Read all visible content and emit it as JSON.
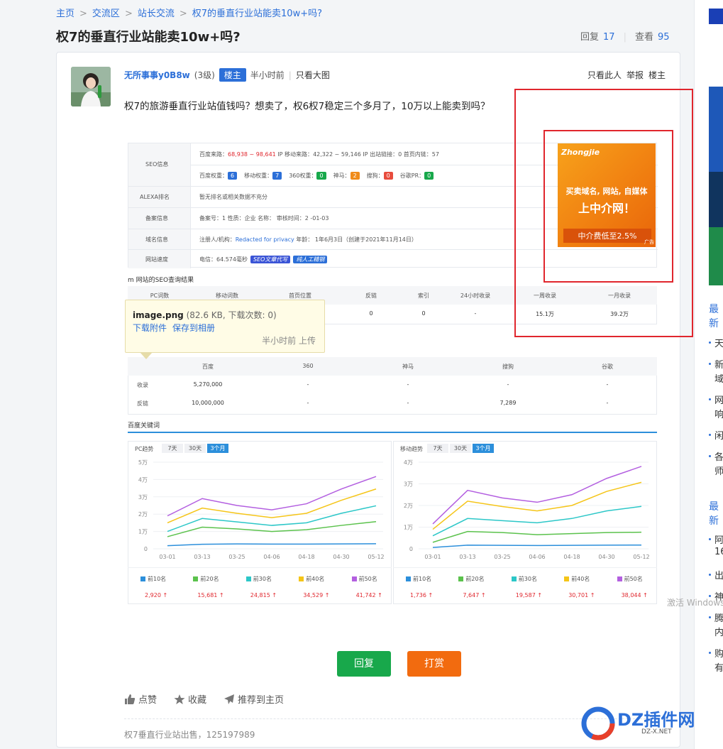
{
  "breadcrumb": [
    "主页",
    "交流区",
    "站长交流",
    "权7的垂直行业站能卖10w+吗?"
  ],
  "thread": {
    "title": "权7的垂直行业站能卖10w+吗?",
    "reply_label": "回复",
    "reply_count": "17",
    "view_label": "查看",
    "view_count": "95"
  },
  "post": {
    "author": "无所事事y0B8w",
    "level": "(3级)",
    "badge": "楼主",
    "time": "半小时前",
    "only_big": "只看大图",
    "tools": [
      "只看此人",
      "举报",
      "楼主"
    ],
    "content": "权7的旅游垂直行业站值钱吗？想卖了，权6权7稳定三个多月了，10万以上能卖到吗？"
  },
  "seo": {
    "rows": [
      {
        "label": "SEO信息",
        "line1_parts": [
          "百度来路：",
          "68,938 ~ 98,641",
          " IP   移动来路：",
          "42,322 ~ 59,146",
          " IP   出站链接：",
          "0",
          "   首页内链：",
          "57"
        ],
        "line2": [
          {
            "k": "百度权重：",
            "v": "6",
            "c": "#2c6fd8"
          },
          {
            "k": "移动权重：",
            "v": "7",
            "c": "#2c6fd8"
          },
          {
            "k": "360权重：",
            "v": "0",
            "c": "#18a84b"
          },
          {
            "k": "神马：",
            "v": "2",
            "c": "#f08c1b"
          },
          {
            "k": "搜狗：",
            "v": "0",
            "c": "#e84c3d"
          },
          {
            "k": "谷歌PR：",
            "v": "0",
            "c": "#18a84b"
          }
        ]
      },
      {
        "label": "ALEXA排名",
        "text": "暂无排名或相关数据不充分"
      },
      {
        "label": "备案信息",
        "text": "备案号：1                     性质：企业   名称：                                审核时间：2    -01-03"
      },
      {
        "label": "域名信息",
        "text_prefix": "注册人/机构：",
        "link": "Redacted for privacy",
        "text_suffix": "   年龄：  1年6月3日（创建于2021年11月14日）"
      },
      {
        "label": "网站速度",
        "text": "电信：64.574毫秒",
        "tag1": "SEO文章代写",
        "tag2": "纯人工精钢"
      }
    ],
    "result_title": "m 网站的SEO查询结果",
    "result_headers": [
      "PC词数",
      "移动词数",
      "首页位置",
      "反链",
      "索引",
      "24小时收录",
      "一周收录",
      "一月收录"
    ],
    "result_values": [
      "",
      "",
      "",
      "0",
      "0",
      "-",
      "15.1万",
      "39.2万"
    ],
    "engine_headers": [
      "",
      "百度",
      "360",
      "神马",
      "搜狗",
      "谷歌"
    ],
    "engine_rows": [
      {
        "label": "收录",
        "values": [
          "5,270,000",
          "-",
          "-",
          "-",
          "-"
        ]
      },
      {
        "label": "反链",
        "values": [
          "10,000,000",
          "-",
          "-",
          "7,289",
          "-"
        ]
      }
    ],
    "kw_title": "百度关键词"
  },
  "tooltip": {
    "filename": "image.png",
    "meta": "(82.6 KB, 下载次数: 0)",
    "download": "下载附件",
    "save": "保存到相册",
    "uploaded": "半小时前 上传"
  },
  "ad": {
    "logo": "Zhongjie",
    "line1": "买卖域名, 网站, 自媒体",
    "line2": "上中介网！",
    "line3": "中介费低至2.5%",
    "tag": "广告"
  },
  "chart_data": [
    {
      "type": "line",
      "title": "PC趋势",
      "tabs": [
        "7天",
        "30天",
        "3个月"
      ],
      "active_tab": "3个月",
      "categories": [
        "03-01",
        "03-13",
        "03-25",
        "04-06",
        "04-18",
        "04-30",
        "05-12"
      ],
      "yticks": [
        "0",
        "1万",
        "2万",
        "3万",
        "4万",
        "5万"
      ],
      "ylim": [
        0,
        50000
      ],
      "series": [
        {
          "name": "前10名",
          "color": "#2c8fdb",
          "values": [
            1800,
            2600,
            2800,
            2700,
            2700,
            2800,
            2900
          ]
        },
        {
          "name": "前20名",
          "color": "#5bc24c",
          "values": [
            7000,
            12500,
            11500,
            10000,
            11000,
            13500,
            15681
          ]
        },
        {
          "name": "前30名",
          "color": "#2cc7c8",
          "values": [
            10000,
            17500,
            15500,
            13500,
            15000,
            20500,
            24815
          ]
        },
        {
          "name": "前40名",
          "color": "#f5c518",
          "values": [
            15000,
            23500,
            20500,
            18000,
            20500,
            28000,
            34529
          ]
        },
        {
          "name": "前50名",
          "color": "#b35fe0",
          "values": [
            19000,
            29000,
            25000,
            22500,
            26000,
            34500,
            41742
          ]
        }
      ],
      "legend_values": [
        "2,920",
        "15,681",
        "24,815",
        "34,529",
        "41,742"
      ]
    },
    {
      "type": "line",
      "title": "移动趋势",
      "tabs": [
        "7天",
        "30天",
        "3个月"
      ],
      "active_tab": "3个月",
      "categories": [
        "03-01",
        "03-13",
        "03-25",
        "04-06",
        "04-18",
        "04-30",
        "05-12"
      ],
      "yticks": [
        "0",
        "1万",
        "2万",
        "3万",
        "4万"
      ],
      "ylim": [
        0,
        40000
      ],
      "series": [
        {
          "name": "前10名",
          "color": "#2c8fdb",
          "values": [
            600,
            1700,
            1600,
            1500,
            1600,
            1700,
            1736
          ]
        },
        {
          "name": "前20名",
          "color": "#5bc24c",
          "values": [
            3000,
            8000,
            7500,
            6500,
            7000,
            7500,
            7647
          ]
        },
        {
          "name": "前30名",
          "color": "#2cc7c8",
          "values": [
            6000,
            14000,
            13000,
            12000,
            14000,
            17500,
            19587
          ]
        },
        {
          "name": "前40名",
          "color": "#f5c518",
          "values": [
            9000,
            22000,
            19500,
            17500,
            20000,
            26500,
            30701
          ]
        },
        {
          "name": "前50名",
          "color": "#b35fe0",
          "values": [
            11500,
            27000,
            23500,
            21500,
            25000,
            32500,
            38044
          ]
        }
      ],
      "legend_values": [
        "1,736",
        "7,647",
        "19,587",
        "30,701",
        "38,044"
      ]
    }
  ],
  "buttons": {
    "reply": "回复",
    "reward": "打赏"
  },
  "actions": [
    "点赞",
    "收藏",
    "推荐到主页"
  ],
  "signature": "权7垂直行业站出售，125197989",
  "activate": "激活 Windows",
  "right_sidebar": {
    "head1": "最新",
    "head2": "最新",
    "items": [
      "天",
      "新",
      "域",
      "网",
      "响",
      "闲",
      "各",
      "师",
      "阿",
      "16",
      "出",
      "神",
      "腾",
      "内",
      "购",
      "有"
    ]
  },
  "watermark": {
    "text": "DZ插件网",
    "sub": "DZ-X.NET"
  }
}
